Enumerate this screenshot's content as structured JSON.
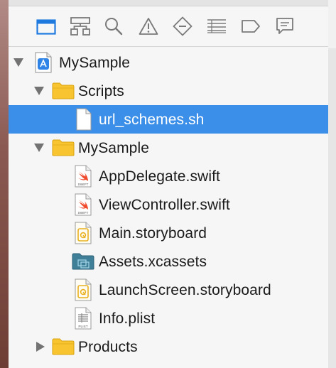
{
  "tabs": [
    {
      "icon": "folder-icon",
      "active": true
    },
    {
      "icon": "hierarchy-icon"
    },
    {
      "icon": "search-icon"
    },
    {
      "icon": "warning-icon"
    },
    {
      "icon": "diamond-minus-icon"
    },
    {
      "icon": "list-icon"
    },
    {
      "icon": "tag-icon"
    },
    {
      "icon": "chat-icon"
    }
  ],
  "tree": {
    "project": "MySample",
    "scripts_group": "Scripts",
    "selected_file": "url_schemes.sh",
    "sources_group": "MySample",
    "files": [
      "AppDelegate.swift",
      "ViewController.swift",
      "Main.storyboard",
      "Assets.xcassets",
      "LaunchScreen.storyboard",
      "Info.plist"
    ],
    "products_group": "Products"
  },
  "swift_badge": "SWIFT",
  "plist_badge": "PLIST",
  "colors": {
    "selection": "#3c8fe8",
    "accent": "#1f7ae0",
    "folder": "#f8c531"
  }
}
